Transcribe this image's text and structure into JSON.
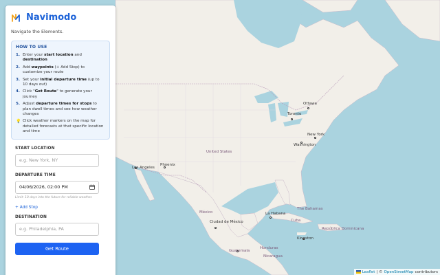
{
  "app": {
    "name": "Navimodo",
    "tagline": "Navigate the Elements."
  },
  "howto": {
    "title": "HOW TO USE",
    "steps": [
      {
        "num": "1.",
        "pre": "Enter your ",
        "b1": "start location",
        "mid": " and ",
        "b2": "destination",
        "post": ""
      },
      {
        "num": "2.",
        "pre": "Add ",
        "b1": "waypoints",
        "mid": " (+ Add Stop) to customize your route",
        "b2": "",
        "post": ""
      },
      {
        "num": "3.",
        "pre": "Set your ",
        "b1": "initial departure time",
        "mid": " (up to 10 days out)",
        "b2": "",
        "post": ""
      },
      {
        "num": "4.",
        "pre": "Click \"",
        "b1": "Get Route",
        "mid": "\" to generate your journey",
        "b2": "",
        "post": ""
      },
      {
        "num": "5.",
        "pre": "Adjust ",
        "b1": "departure times for stops",
        "mid": " to plan dwell times and see how weather changes",
        "b2": "",
        "post": ""
      }
    ],
    "tip": "Click weather markers on the map for detailed forecasts at that specific location and time"
  },
  "form": {
    "start_label": "START LOCATION",
    "start_placeholder": "e.g. New York, NY",
    "departure_label": "DEPARTURE TIME",
    "departure_value": "04/06/2026, 02:00 PM",
    "departure_hint": "Limit: 10 days into the future for reliable weather.",
    "add_stop": "+ Add Stop",
    "dest_label": "DESTINATION",
    "dest_placeholder": "e.g. Philadelphia, PA",
    "submit": "Get Route"
  },
  "map": {
    "labels": [
      {
        "name": "Ottawa",
        "kind": "city"
      },
      {
        "name": "Toronto",
        "kind": "city"
      },
      {
        "name": "New York",
        "kind": "city"
      },
      {
        "name": "Washington",
        "kind": "city"
      },
      {
        "name": "United States",
        "kind": "country"
      },
      {
        "name": "Los Angeles",
        "kind": "city"
      },
      {
        "name": "Phoenix",
        "kind": "city"
      },
      {
        "name": "México",
        "kind": "country"
      },
      {
        "name": "Ciudad de México",
        "kind": "city"
      },
      {
        "name": "La Habana",
        "kind": "city"
      },
      {
        "name": "Cuba",
        "kind": "country"
      },
      {
        "name": "The Bahamas",
        "kind": "country"
      },
      {
        "name": "República Dominicana",
        "kind": "country"
      },
      {
        "name": "Kingston",
        "kind": "city"
      },
      {
        "name": "Guatemala",
        "kind": "country"
      },
      {
        "name": "Honduras",
        "kind": "country"
      },
      {
        "name": "Nicaragua",
        "kind": "country"
      }
    ],
    "attribution_leaflet": "Leaflet",
    "attribution_sep": " | © ",
    "attribution_osm": "OpenStreetMap",
    "attribution_rest": " contributors"
  },
  "colors": {
    "water": "#aad3df",
    "land": "#f2efe9",
    "accent": "#1d63f2",
    "brand": "#1d63d8"
  }
}
